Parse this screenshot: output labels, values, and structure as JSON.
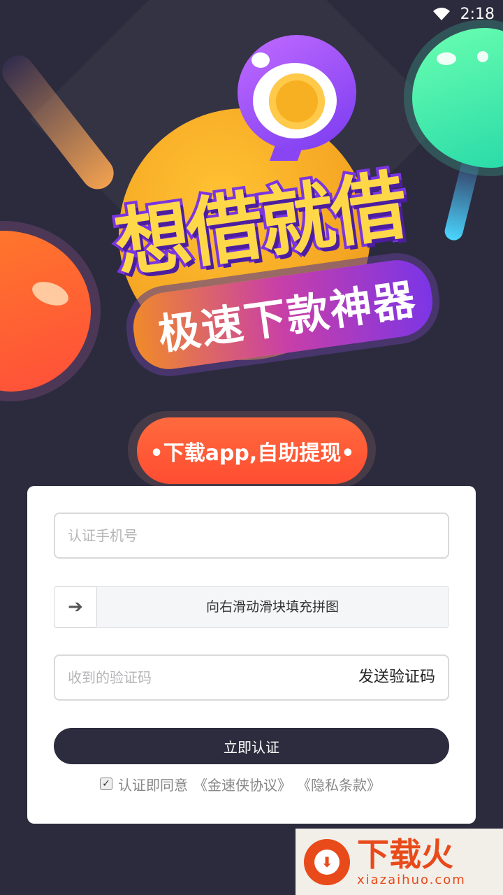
{
  "status_bar": {
    "time": "2:18",
    "wifi_icon": "wifi-icon"
  },
  "hero": {
    "title": "想借就借",
    "subtitle": "极速下款神器",
    "coin_icon": "coin-icon"
  },
  "download": {
    "label": "•下载app,自助提现•"
  },
  "form": {
    "phone_placeholder": "认证手机号",
    "slider_text": "向右滑动滑块填充拼图",
    "slider_icon": "arrow-right-icon",
    "code_placeholder": "收到的验证码",
    "send_code_label": "发送验证码",
    "submit_label": "立即认证",
    "agree_checked": true,
    "agree_text": "认证即同意",
    "agreement_link": "《金速侠协议》",
    "privacy_link": "《隐私条款》"
  },
  "watermark": {
    "title": "下载火",
    "subtitle": "xiazaihuo.com"
  },
  "colors": {
    "background": "#2b2b3d",
    "accent_orange": "#ff5a35",
    "button_dark": "#2c2c3e",
    "hero_yellow": "#ffd84a",
    "hero_purple": "#7a35e0"
  }
}
